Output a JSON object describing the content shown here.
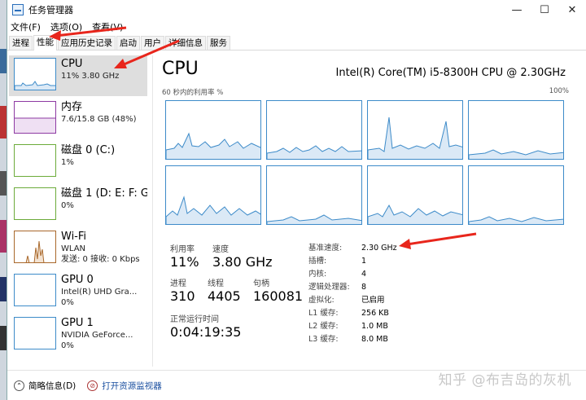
{
  "window": {
    "title": "任务管理器",
    "minimize": "—",
    "maximize": "☐",
    "close": "✕"
  },
  "menu": [
    "文件(F)",
    "选项(O)",
    "查看(V)"
  ],
  "tabs": [
    {
      "label": "进程",
      "active": false
    },
    {
      "label": "性能",
      "active": true
    },
    {
      "label": "应用历史记录",
      "active": false
    },
    {
      "label": "启动",
      "active": false
    },
    {
      "label": "用户",
      "active": false
    },
    {
      "label": "详细信息",
      "active": false
    },
    {
      "label": "服务",
      "active": false
    }
  ],
  "resources": [
    {
      "name": "CPU",
      "sub1": "11% 3.80 GHz",
      "sub2": "",
      "kind": "cpu",
      "selected": true
    },
    {
      "name": "内存",
      "sub1": "7.6/15.8 GB (48%)",
      "sub2": "",
      "kind": "mem",
      "selected": false
    },
    {
      "name": "磁盘 0 (C:)",
      "sub1": "1%",
      "sub2": "",
      "kind": "disk",
      "selected": false
    },
    {
      "name": "磁盘 1 (D: E: F: G:",
      "sub1": "0%",
      "sub2": "",
      "kind": "disk",
      "selected": false
    },
    {
      "name": "Wi-Fi",
      "sub1": "WLAN",
      "sub2": "发送: 0 接收: 0 Kbps",
      "kind": "wifi",
      "selected": false
    },
    {
      "name": "GPU 0",
      "sub1": "Intel(R) UHD Gra...",
      "sub2": "0%",
      "kind": "gpu",
      "selected": false
    },
    {
      "name": "GPU 1",
      "sub1": "NVIDIA GeForce...",
      "sub2": "0%",
      "kind": "gpu",
      "selected": false
    }
  ],
  "main": {
    "title": "CPU",
    "model": "Intel(R) Core(TM) i5-8300H CPU @ 2.30GHz",
    "graph_left_label": "60 秒内的利用率 %",
    "graph_right_label": "100%"
  },
  "stats": {
    "utilization_label": "利用率",
    "utilization": "11%",
    "speed_label": "速度",
    "speed": "3.80 GHz",
    "processes_label": "进程",
    "processes": "310",
    "threads_label": "线程",
    "threads": "4405",
    "handles_label": "句柄",
    "handles": "160081",
    "uptime_label": "正常运行时间",
    "uptime": "0:04:19:35"
  },
  "details": [
    {
      "k": "基准速度:",
      "v": "2.30 GHz"
    },
    {
      "k": "插槽:",
      "v": "1"
    },
    {
      "k": "内核:",
      "v": "4"
    },
    {
      "k": "逻辑处理器:",
      "v": "8"
    },
    {
      "k": "虚拟化:",
      "v": "已启用"
    },
    {
      "k": "L1 缓存:",
      "v": "256 KB"
    },
    {
      "k": "L2 缓存:",
      "v": "1.0 MB"
    },
    {
      "k": "L3 缓存:",
      "v": "8.0 MB"
    }
  ],
  "footer": {
    "summary": "简略信息(D)",
    "resmon": "打开资源监视器"
  },
  "watermark": "知乎 @布吉岛的灰机",
  "colors": {
    "cpu": "#3d8bc9",
    "memory": "#8e3aa3",
    "disk": "#6cab3a",
    "wifi": "#a9682b",
    "annotation": "#e8261c"
  }
}
